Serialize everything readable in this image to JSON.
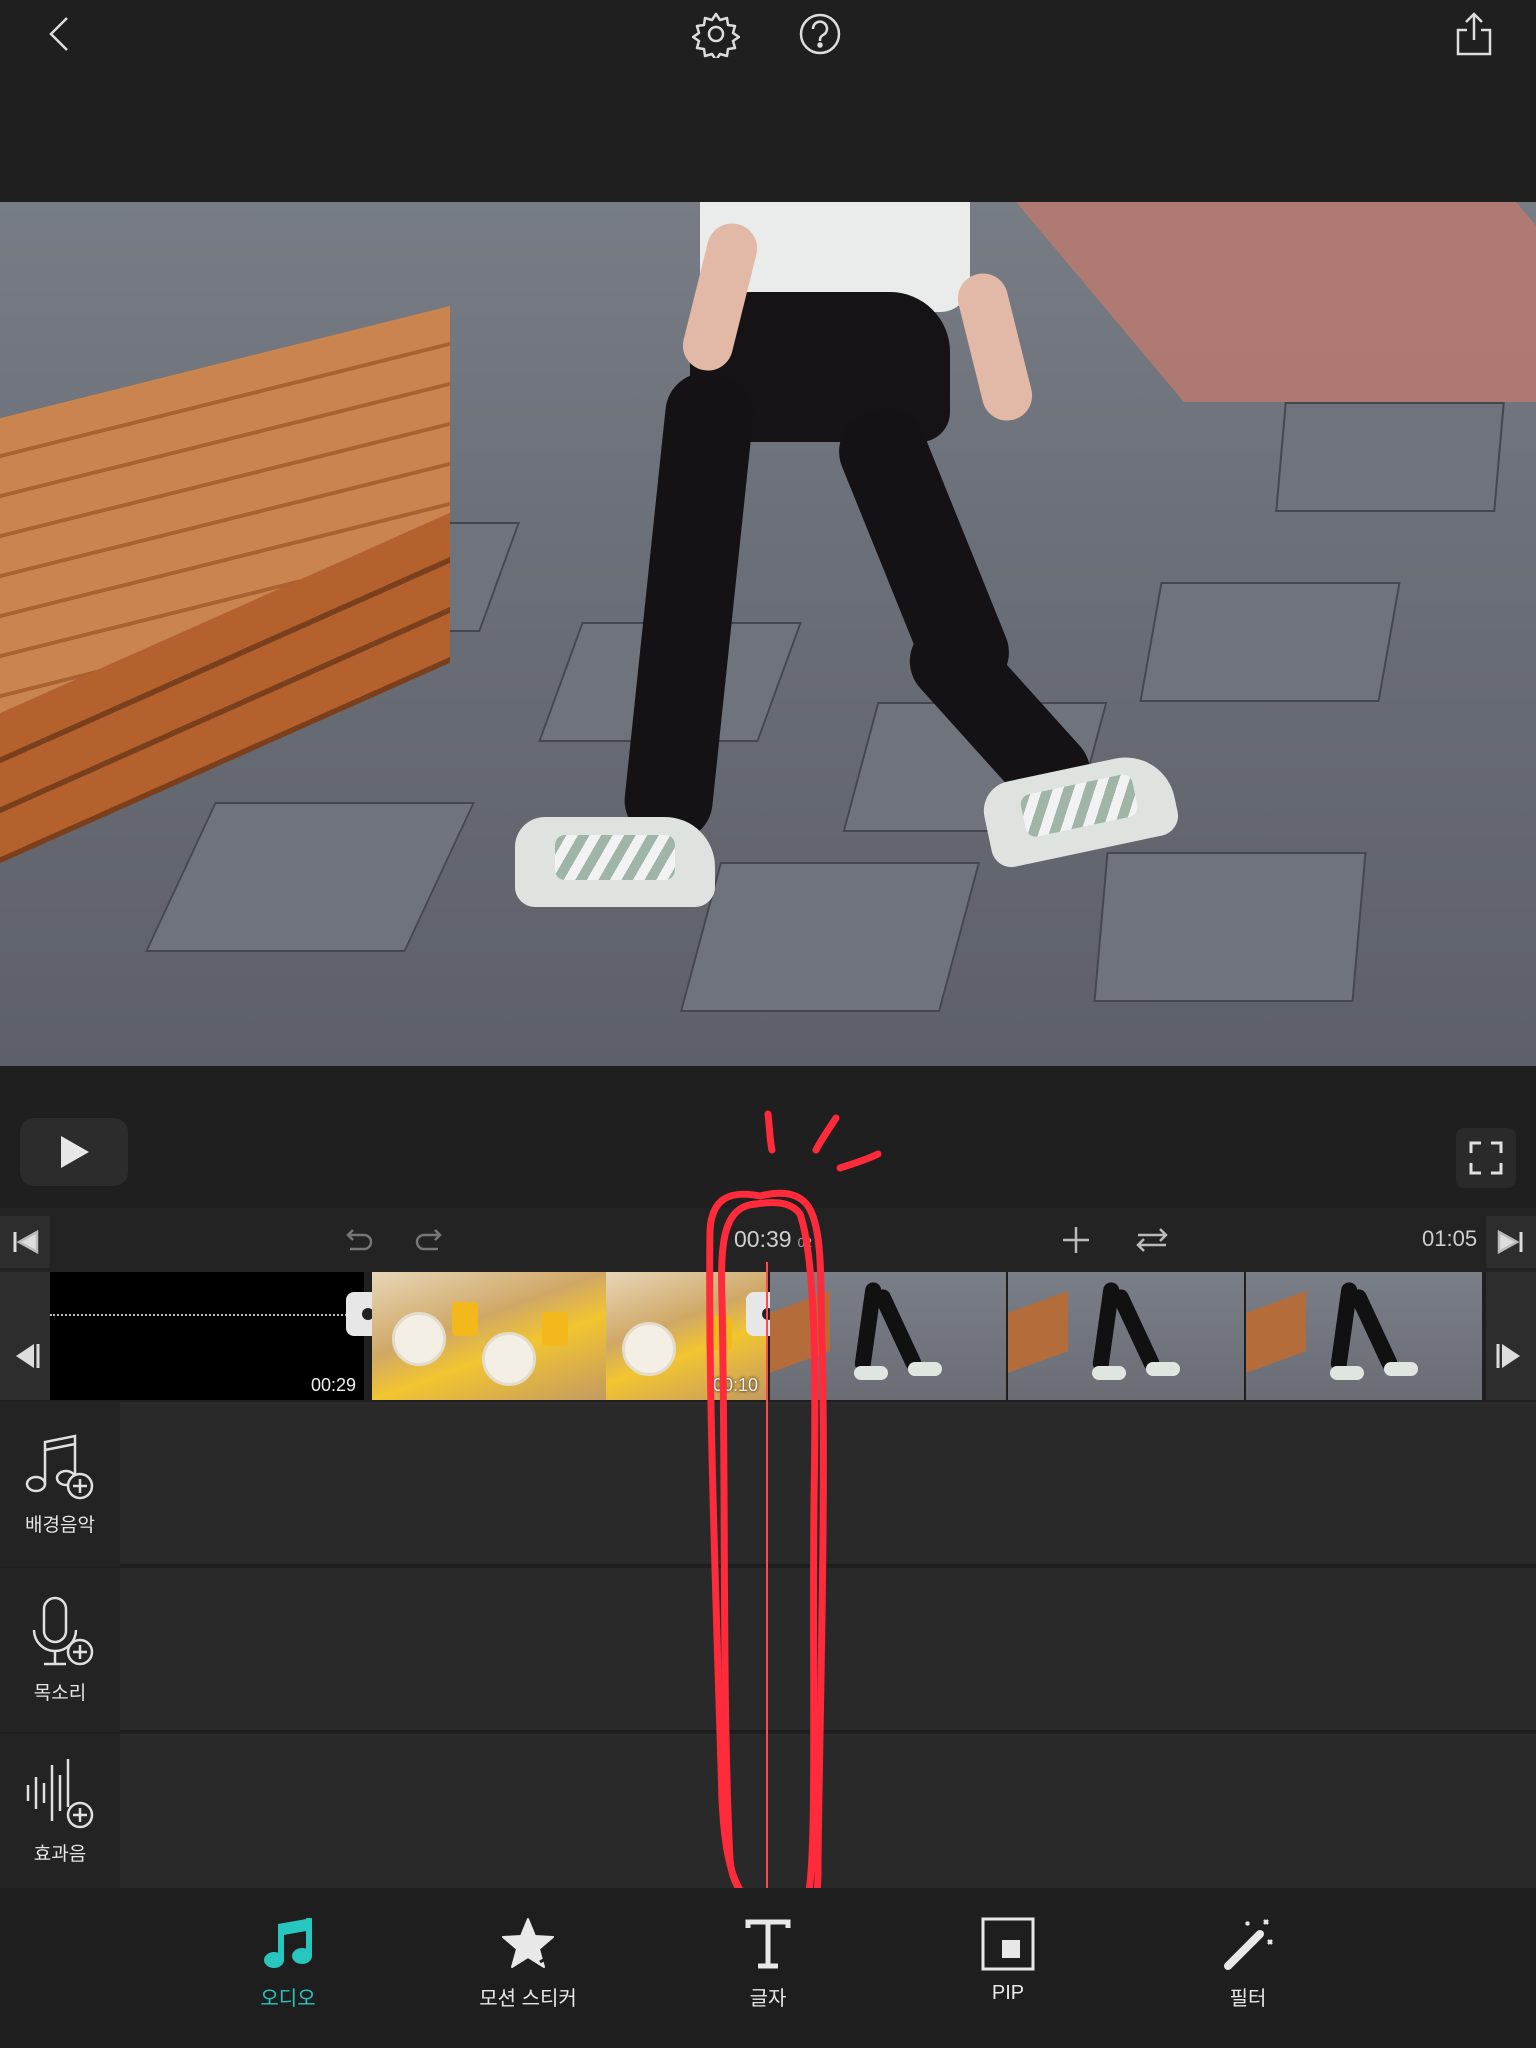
{
  "timeline": {
    "current_time": "00:39",
    "current_frame": "02",
    "total_time": "01:05"
  },
  "clips": [
    {
      "label": "00:29"
    },
    {
      "label": "00:10"
    }
  ],
  "tracks": [
    {
      "label": "배경음악",
      "icon": "music-note-add-icon"
    },
    {
      "label": "목소리",
      "icon": "microphone-add-icon"
    },
    {
      "label": "효과음",
      "icon": "waveform-add-icon"
    }
  ],
  "toolbar": {
    "items": [
      {
        "label": "오디오",
        "icon": "music-note-icon",
        "active": true
      },
      {
        "label": "모션 스티커",
        "icon": "star-sticker-icon",
        "active": false
      },
      {
        "label": "글자",
        "icon": "text-t-icon",
        "active": false
      },
      {
        "label": "PIP",
        "icon": "pip-icon",
        "active": false
      },
      {
        "label": "필터",
        "icon": "magic-wand-icon",
        "active": false
      }
    ]
  },
  "colors": {
    "background": "#1f1f1f",
    "accent": "#27c7c0",
    "playhead": "#ff4a4a",
    "annotation": "#ff2b3a"
  }
}
